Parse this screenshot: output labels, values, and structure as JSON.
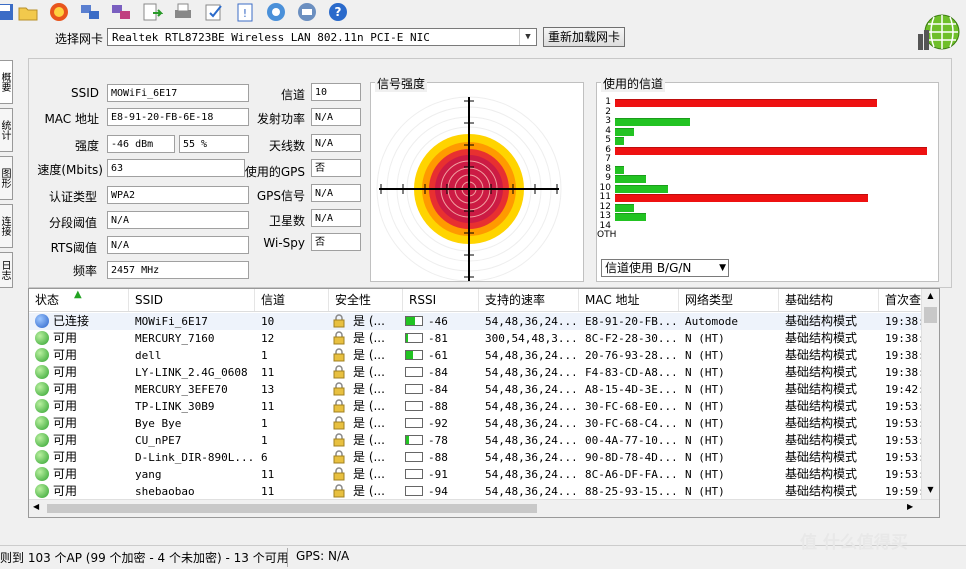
{
  "toolbar": {
    "icons": [
      "save-icon",
      "open-folder-icon",
      "start-scan-icon",
      "computers-icon",
      "network-icon",
      "export-icon",
      "print-icon",
      "options-icon",
      "clipboard-icon",
      "web-icon",
      "comment-icon",
      "help-icon"
    ]
  },
  "nic": {
    "label": "选择网卡",
    "value": "Realtek RTL8723BE Wireless LAN 802.11n PCI-E NIC",
    "reload_label": "重新加载网卡"
  },
  "side_tabs": [
    "概要",
    "统计",
    "图形",
    "连接",
    "日志"
  ],
  "info": {
    "ssid_label": "SSID",
    "ssid": "MOWiFi_6E17",
    "mac_label": "MAC 地址",
    "mac": "E8-91-20-FB-6E-18",
    "strength_label": "强度",
    "strength_dbm": "-46 dBm",
    "strength_pct": "55 %",
    "speed_label": "速度(Mbits)",
    "speed": "63",
    "auth_label": "认证类型",
    "auth": "WPA2",
    "frag_label": "分段阈值",
    "frag": "N/A",
    "rts_label": "RTS阈值",
    "rts": "N/A",
    "freq_label": "频率",
    "freq": "2457 MHz",
    "channel_label": "信道",
    "channel": "10",
    "txpower_label": "发射功率",
    "txpower": "N/A",
    "antenna_label": "天线数",
    "antenna": "N/A",
    "gps_used_label": "使用的GPS",
    "gps_used": "否",
    "gps_signal_label": "GPS信号",
    "gps_signal": "N/A",
    "satellite_label": "卫星数",
    "satellite": "N/A",
    "wispy_label": "Wi-Spy",
    "wispy": "否"
  },
  "signal_strength": {
    "title": "信号强度"
  },
  "channels_used": {
    "title": "使用的信道",
    "select_value": "信道使用 B/G/N",
    "rows": [
      {
        "label": "1",
        "level": 0.84,
        "color": "#ee1111"
      },
      {
        "label": "2",
        "level": 0,
        "color": "#22c322"
      },
      {
        "label": "3",
        "level": 0.24,
        "color": "#22c322"
      },
      {
        "label": "4",
        "level": 0.06,
        "color": "#22c322"
      },
      {
        "label": "5",
        "level": 0.03,
        "color": "#22c322"
      },
      {
        "label": "6",
        "level": 1.0,
        "color": "#ee1111"
      },
      {
        "label": "7",
        "level": 0,
        "color": "#22c322"
      },
      {
        "label": "8",
        "level": 0.03,
        "color": "#22c322"
      },
      {
        "label": "9",
        "level": 0.1,
        "color": "#22c322"
      },
      {
        "label": "10",
        "level": 0.17,
        "color": "#22c322"
      },
      {
        "label": "11",
        "level": 0.81,
        "color": "#ee1111"
      },
      {
        "label": "12",
        "level": 0.06,
        "color": "#22c322"
      },
      {
        "label": "13",
        "level": 0.1,
        "color": "#22c322"
      },
      {
        "label": "14",
        "level": 0,
        "color": "#22c322"
      },
      {
        "label": "OTH",
        "level": 0,
        "color": "#22c322"
      }
    ]
  },
  "table": {
    "columns": [
      "状态",
      "SSID",
      "信道",
      "安全性",
      "RSSI",
      "支持的速率",
      "MAC 地址",
      "网络类型",
      "基础结构",
      "首次查"
    ],
    "rows": [
      {
        "status": "已连接",
        "ssid": "MOWiFi_6E17",
        "channel": "10",
        "security": "是 (...",
        "rssi": "-46",
        "rssi_level": 0.55,
        "rates": "54,48,36,24...",
        "mac": "E8-91-20-FB...",
        "type": "Automode",
        "infra": "基础结构模式",
        "first": "19:38:",
        "connected": true
      },
      {
        "status": "可用",
        "ssid": "MERCURY_7160",
        "channel": "12",
        "security": "是 (...",
        "rssi": "-81",
        "rssi_level": 0.1,
        "rates": "300,54,48,3...",
        "mac": "8C-F2-28-30...",
        "type": "N (HT)",
        "infra": "基础结构模式",
        "first": "19:38:",
        "connected": false
      },
      {
        "status": "可用",
        "ssid": "dell",
        "channel": "1",
        "security": "是 (...",
        "rssi": "-61",
        "rssi_level": 0.45,
        "rates": "54,48,36,24...",
        "mac": "20-76-93-28...",
        "type": "N (HT)",
        "infra": "基础结构模式",
        "first": "19:38:",
        "connected": false
      },
      {
        "status": "可用",
        "ssid": "LY-LINK_2.4G_0608",
        "channel": "11",
        "security": "是 (...",
        "rssi": "-84",
        "rssi_level": 0,
        "rates": "54,48,36,24...",
        "mac": "F4-83-CD-A8...",
        "type": "N (HT)",
        "infra": "基础结构模式",
        "first": "19:38:",
        "connected": false
      },
      {
        "status": "可用",
        "ssid": "MERCURY_3EFE70",
        "channel": "13",
        "security": "是 (...",
        "rssi": "-84",
        "rssi_level": 0,
        "rates": "54,48,36,24...",
        "mac": "A8-15-4D-3E...",
        "type": "N (HT)",
        "infra": "基础结构模式",
        "first": "19:42:",
        "connected": false
      },
      {
        "status": "可用",
        "ssid": "TP-LINK_30B9",
        "channel": "11",
        "security": "是 (...",
        "rssi": "-88",
        "rssi_level": 0,
        "rates": "54,48,36,24...",
        "mac": "30-FC-68-E0...",
        "type": "N (HT)",
        "infra": "基础结构模式",
        "first": "19:53:",
        "connected": false
      },
      {
        "status": "可用",
        "ssid": "Bye Bye",
        "channel": "1",
        "security": "是 (...",
        "rssi": "-92",
        "rssi_level": 0,
        "rates": "54,48,36,24...",
        "mac": "30-FC-68-C4...",
        "type": "N (HT)",
        "infra": "基础结构模式",
        "first": "19:53:",
        "connected": false
      },
      {
        "status": "可用",
        "ssid": "CU_nPE7",
        "channel": "1",
        "security": "是 (...",
        "rssi": "-78",
        "rssi_level": 0.2,
        "rates": "54,48,36,24...",
        "mac": "00-4A-77-10...",
        "type": "N (HT)",
        "infra": "基础结构模式",
        "first": "19:53:",
        "connected": false
      },
      {
        "status": "可用",
        "ssid": "D-Link_DIR-890L...",
        "channel": "6",
        "security": "是 (...",
        "rssi": "-88",
        "rssi_level": 0,
        "rates": "54,48,36,24...",
        "mac": "90-8D-78-4D...",
        "type": "N (HT)",
        "infra": "基础结构模式",
        "first": "19:53:",
        "connected": false
      },
      {
        "status": "可用",
        "ssid": "yang",
        "channel": "11",
        "security": "是 (...",
        "rssi": "-91",
        "rssi_level": 0,
        "rates": "54,48,36,24...",
        "mac": "8C-A6-DF-FA...",
        "type": "N (HT)",
        "infra": "基础结构模式",
        "first": "19:53:",
        "connected": false
      },
      {
        "status": "可用",
        "ssid": "shebaobao",
        "channel": "11",
        "security": "是 (...",
        "rssi": "-94",
        "rssi_level": 0,
        "rates": "54,48,36,24...",
        "mac": "88-25-93-15...",
        "type": "N (HT)",
        "infra": "基础结构模式",
        "first": "19:59:",
        "connected": false
      }
    ]
  },
  "status": {
    "ap_summary": "则到 103 个AP (99 个加密 - 4 个未加密) - 13 个可用",
    "gps": "GPS: N/A"
  },
  "watermark": "值 什么值得买"
}
